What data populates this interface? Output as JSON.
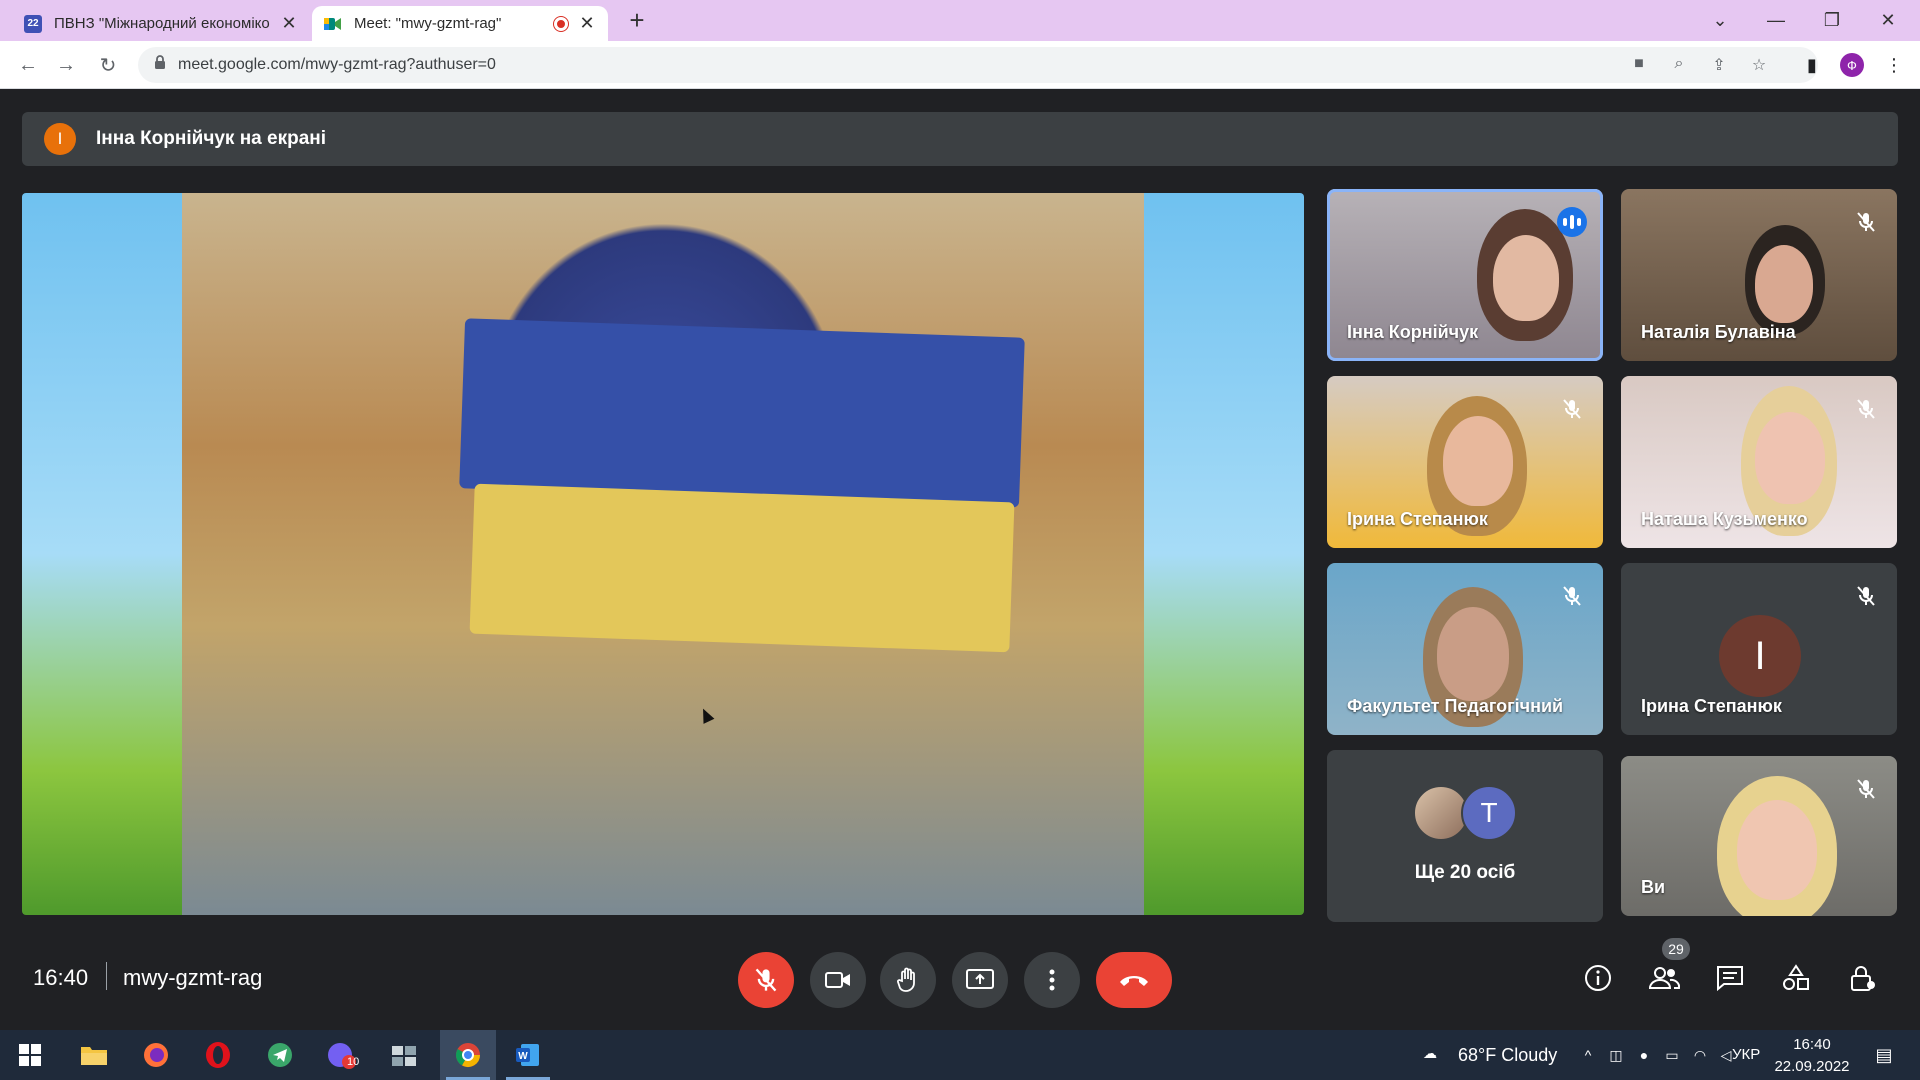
{
  "browser": {
    "tabs": [
      {
        "title": "ПВНЗ \"Міжнародний економіко",
        "favicon_label": "22",
        "favicon_color": "#3f51b5"
      },
      {
        "title": "Meet: \"mwy-gzmt-rag\"",
        "favicon_label": "",
        "favicon_color": "#00897b"
      }
    ],
    "new_tab_symbol": "+",
    "url": "meet.google.com/mwy-gzmt-rag?authuser=0",
    "profile_initial": "Ф"
  },
  "meet": {
    "presenter_banner": {
      "avatar_initial": "І",
      "text": "Інна Корнійчук на екрані"
    },
    "participants": [
      {
        "name": "Інна Корнійчук",
        "speaking": true,
        "muted": false
      },
      {
        "name": "Наталія Булавіна",
        "speaking": false,
        "muted": true
      },
      {
        "name": "Ірина Степанюк",
        "speaking": false,
        "muted": true
      },
      {
        "name": "Наташа Кузьменко",
        "speaking": false,
        "muted": true
      },
      {
        "name": "Факультет Педагогічний",
        "speaking": false,
        "muted": true
      },
      {
        "name": "Ірина Степанюк",
        "speaking": false,
        "muted": true,
        "avatar_initial": "І"
      },
      {
        "name": "Ви",
        "speaking": false,
        "muted": true
      }
    ],
    "more_people": {
      "label": "Ще 20 осіб",
      "avatar_initial": "T"
    },
    "time": "16:40",
    "meeting_code": "mwy-gzmt-rag",
    "participants_count": "29"
  },
  "taskbar": {
    "weather": "68°F  Cloudy",
    "language": "УКР",
    "time": "16:40",
    "date": "22.09.2022",
    "viber_badge": "10"
  },
  "colors": {
    "meet_bg": "#202124",
    "tile_bg": "#3c4043",
    "hangup_red": "#ea4335",
    "speaking_blue": "#8ab4f8",
    "tab_strip": "#e6c7f2"
  }
}
